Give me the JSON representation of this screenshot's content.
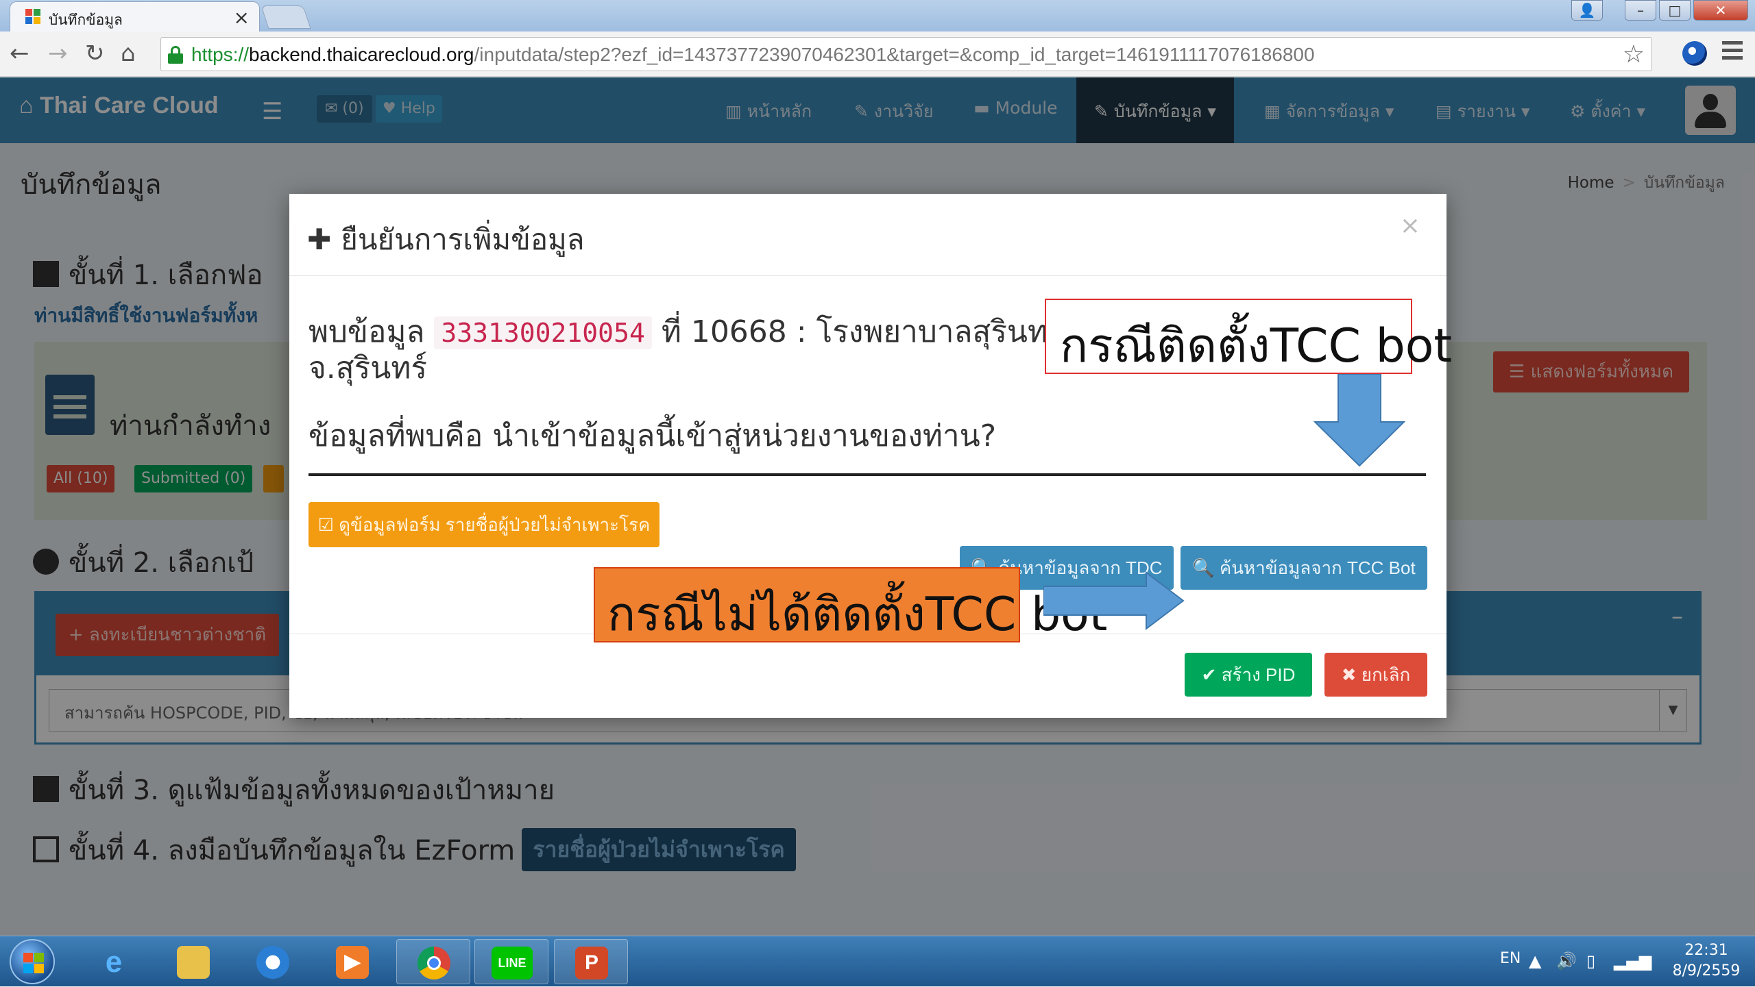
{
  "browser": {
    "tab_title": "บันทึกข้อมูล",
    "tab_close": "×",
    "url_scheme": "https://",
    "url_host": "backend.thaicarecloud.org",
    "url_path": "/inputdata/step2?ezf_id=1437377239070462301&target=&comp_id_target=1461911117076186800",
    "window_controls": [
      "–",
      "□",
      "✕"
    ]
  },
  "header": {
    "brand": "Thai Care Cloud",
    "messages_badge": "✉ (0)",
    "help_label": "♥ Help",
    "nav": [
      "หน้าหลัก",
      "งานวิจัย",
      "Module",
      "บันทึกข้อมูล",
      "จัดการข้อมูล",
      "รายงาน",
      "ตั้งค่า"
    ],
    "active_nav": "บันทึกข้อมูล"
  },
  "page": {
    "title": "บันทึกข้อมูล",
    "breadcrumb": [
      "Home",
      "บันทึกข้อมูล"
    ],
    "step1_title": "ขั้นที่ 1. เลือกฟอ",
    "step1_sub": "ท่านมีสิทธิ์ใช้งานฟอร์มทั้งห",
    "working_text": "ท่านกำลังทำง",
    "badges": [
      {
        "label": "All (10)",
        "color": "#dd4b39"
      },
      {
        "label": "Submitted (0)",
        "color": "#00a65a"
      }
    ],
    "show_all_forms": "☰ แสดงฟอร์มทั้งหมด",
    "step2_title": "ขั้นที่ 2. เลือกเป้",
    "register_foreigner": "+ ลงทะเบียนชาวต่างชาติ",
    "search_placeholder": "สามารถค้น HOSPCODE, PID, ชื่อ, นามสกุล, เลขบัตรประชาชน",
    "step3_title": "ขั้นที่ 3. ดูแฟ้มข้อมูลทั้งหมดของเป้าหมาย",
    "step4_title": "ขั้นที่ 4. ลงมือบันทึกข้อมูลใน EzForm",
    "step4_tag": "รายชื่อผู้ป่วยไม่จำเพาะโรค"
  },
  "modal": {
    "title": "ยืนยันการเพิ่มข้อมูล",
    "close": "×",
    "found_prefix": "พบข้อมูล",
    "pid": "3331300210054",
    "found_suffix": "ที่ 10668 : โรงพยาบาลสุรินทร์ ต.ในเมือง อ.เมืองสุรินทร์ จ.สุรินทร์",
    "question": "ข้อมูลที่พบคือ นำเข้าข้อมูลนี้เข้าสู่หน่วยงานของท่าน?",
    "view_form_btn": "☑ ดูข้อมูลฟอร์ม รายชื่อผู้ป่วยไม่จำเพาะโรค",
    "search_tdc_btn": "🔍 ค้นหาข้อมูลจาก TDC",
    "search_tcc_btn": "🔍 ค้นหาข้อมูลจาก TCC Bot",
    "create_pid_btn": "✔ สร้าง PID",
    "cancel_btn": "✖ ยกเลิก"
  },
  "annotations": {
    "with_bot": "กรณีติดตั้งTCC bot",
    "without_bot": "กรณีไม่ได้ติดตั้งTCC bot",
    "arrow_color": "#5b9bd5"
  },
  "taskbar": {
    "apps": [
      "start",
      "internet-explorer",
      "file-explorer",
      "messenger",
      "media-player",
      "chrome",
      "line",
      "powerpoint"
    ],
    "language": "EN",
    "time": "22:31",
    "date": "8/9/2559"
  }
}
